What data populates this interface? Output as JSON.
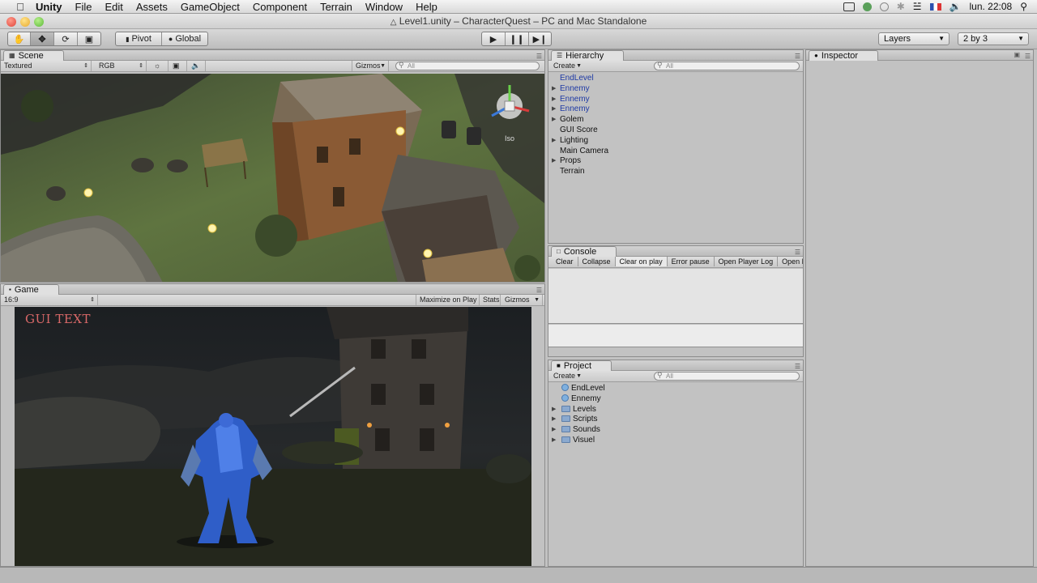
{
  "menubar": {
    "app_name": "Unity",
    "items": [
      "File",
      "Edit",
      "Assets",
      "GameObject",
      "Component",
      "Terrain",
      "Window",
      "Help"
    ],
    "clock": "lun. 22:08"
  },
  "window": {
    "title": "Level1.unity – CharacterQuest – PC and Mac Standalone"
  },
  "toolbar": {
    "tools": [
      "hand-icon",
      "move-icon",
      "rotate-icon",
      "scale-icon"
    ],
    "pivot_label": "Pivot",
    "global_label": "Global",
    "layers_label": "Layers",
    "layout_label": "2 by 3"
  },
  "scene": {
    "tab_label": "Scene",
    "render_mode": "Textured",
    "color_mode": "RGB",
    "gizmos_label": "Gizmos",
    "search_placeholder": "All",
    "projection_label": "Iso"
  },
  "game": {
    "tab_label": "Game",
    "aspect": "16:9",
    "maximize_label": "Maximize on Play",
    "stats_label": "Stats",
    "gizmos_label": "Gizmos",
    "gui_text": "GUI TEXT"
  },
  "hierarchy": {
    "tab_label": "Hierarchy",
    "create_label": "Create",
    "search_placeholder": "All",
    "items": [
      {
        "label": "EndLevel",
        "expandable": false,
        "prefab": true
      },
      {
        "label": "Ennemy",
        "expandable": true,
        "prefab": true
      },
      {
        "label": "Ennemy",
        "expandable": true,
        "prefab": true
      },
      {
        "label": "Ennemy",
        "expandable": true,
        "prefab": true
      },
      {
        "label": "Golem",
        "expandable": true,
        "prefab": false
      },
      {
        "label": "GUI Score",
        "expandable": false,
        "prefab": false
      },
      {
        "label": "Lighting",
        "expandable": true,
        "prefab": false
      },
      {
        "label": "Main Camera",
        "expandable": false,
        "prefab": false
      },
      {
        "label": "Props",
        "expandable": true,
        "prefab": false
      },
      {
        "label": "Terrain",
        "expandable": false,
        "prefab": false
      }
    ]
  },
  "console": {
    "tab_label": "Console",
    "buttons": [
      "Clear",
      "Collapse",
      "Clear on play",
      "Error pause",
      "Open Player Log",
      "Open Edi"
    ]
  },
  "project": {
    "tab_label": "Project",
    "create_label": "Create",
    "search_placeholder": "All",
    "items": [
      {
        "label": "EndLevel",
        "type": "prefab"
      },
      {
        "label": "Ennemy",
        "type": "prefab"
      },
      {
        "label": "Levels",
        "type": "folder"
      },
      {
        "label": "Scripts",
        "type": "folder"
      },
      {
        "label": "Sounds",
        "type": "folder"
      },
      {
        "label": "Visuel",
        "type": "folder"
      }
    ]
  },
  "inspector": {
    "tab_label": "Inspector"
  },
  "colors": {
    "prefab_text": "#1f3aa5",
    "gui_text": "#d96868",
    "panel_bg": "#c2c2c2"
  }
}
